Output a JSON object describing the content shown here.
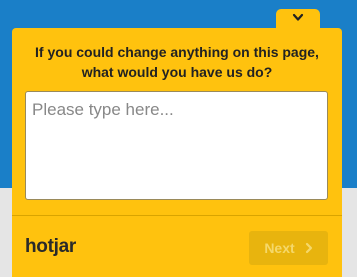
{
  "survey": {
    "question": "If you could change anything on this page, what would you have us do?",
    "answer_placeholder": "Please type here...",
    "answer_value": ""
  },
  "footer": {
    "brand": "hotjar",
    "next_label": "Next"
  },
  "icons": {
    "collapse": "chevron-down-icon",
    "next": "chevron-right-icon"
  },
  "colors": {
    "panel": "#ffc20e",
    "background": "#1a7fc8",
    "next_button": "#e8b40e"
  }
}
